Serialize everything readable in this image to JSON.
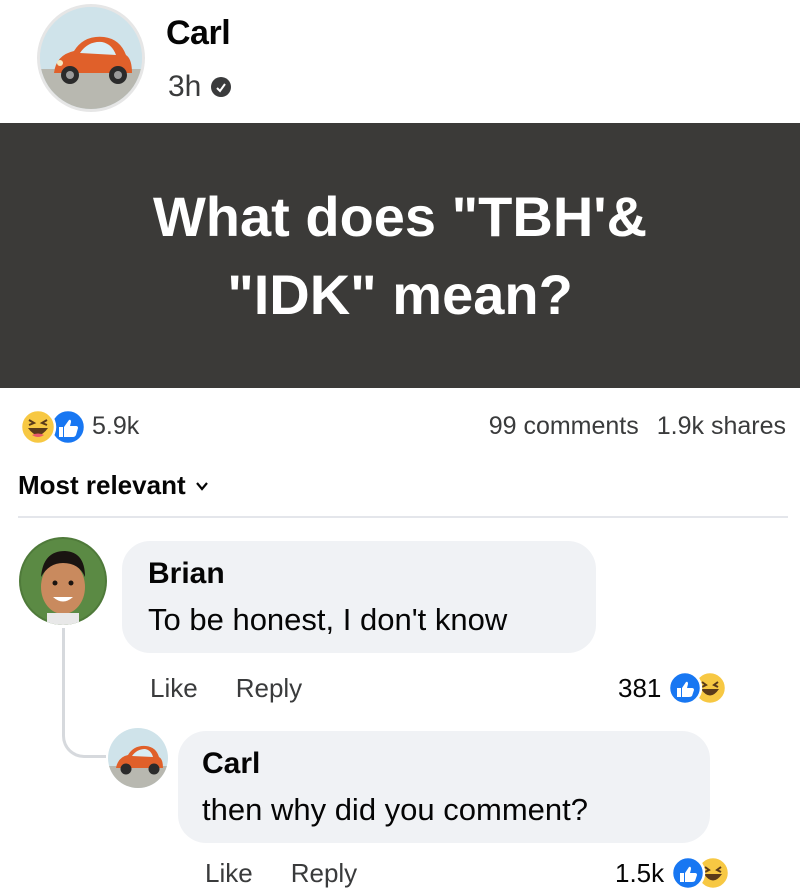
{
  "post": {
    "author": "Carl",
    "time": "3h",
    "text_line1": "What does \"TBH'&",
    "text_line2": "\"IDK\" mean?",
    "reaction_count": "5.9k",
    "comments": "99 comments",
    "shares": "1.9k shares",
    "reaction_icons": [
      "haha-icon",
      "like-icon"
    ]
  },
  "sort": {
    "label": "Most relevant"
  },
  "comments": [
    {
      "author": "Brian",
      "text": "To be honest, I don't know",
      "like_label": "Like",
      "reply_label": "Reply",
      "reaction_count": "381"
    },
    {
      "author": "Carl",
      "text": "then why did you comment?",
      "like_label": "Like",
      "reply_label": "Reply",
      "reaction_count": "1.5k"
    }
  ],
  "colors": {
    "banner": "#3b3a38",
    "like_blue": "#1877f2",
    "haha_yellow": "#f7c843",
    "bubble": "#f0f2f5"
  }
}
